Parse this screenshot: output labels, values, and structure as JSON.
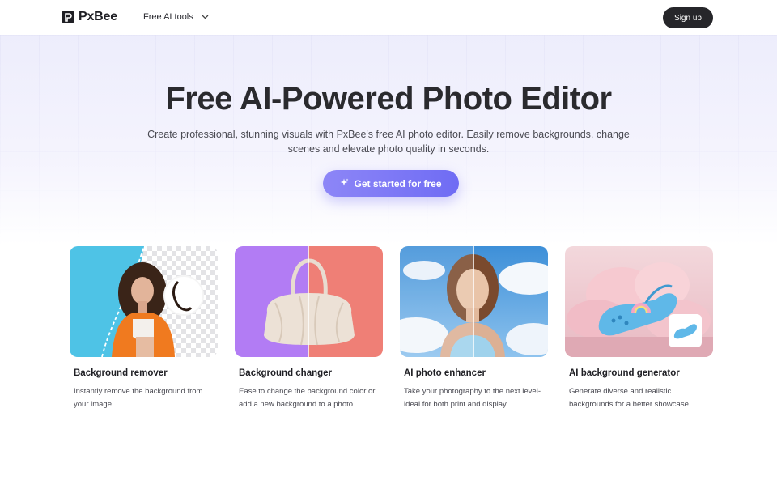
{
  "header": {
    "brand": "PxBee",
    "nav_tools_label": "Free AI tools",
    "signup_label": "Sign up"
  },
  "hero": {
    "title": "Free AI-Powered Photo Editor",
    "subtitle": "Create professional, stunning visuals with PxBee's free AI photo editor. Easily remove backgrounds, change scenes and elevate photo quality in seconds.",
    "cta_label": "Get started for free"
  },
  "tools": [
    {
      "title": "Background remover",
      "description": "Instantly remove the background from your image."
    },
    {
      "title": "Background changer",
      "description": "Ease to change the background color or add a new background to a photo."
    },
    {
      "title": "AI photo enhancer",
      "description": "Take your photography to the next level-ideal for both print and display."
    },
    {
      "title": "AI background generator",
      "description": "Generate diverse and realistic backgrounds for a better showcase."
    }
  ],
  "colors": {
    "brand_dark": "#26262a",
    "cta_gradient_start": "#8d86f7",
    "cta_gradient_end": "#6f6cf4"
  },
  "icons": {
    "logo": "pxbee-logo-icon",
    "nav_chevron": "chevron-down-icon",
    "cta": "sparkle-icon"
  }
}
